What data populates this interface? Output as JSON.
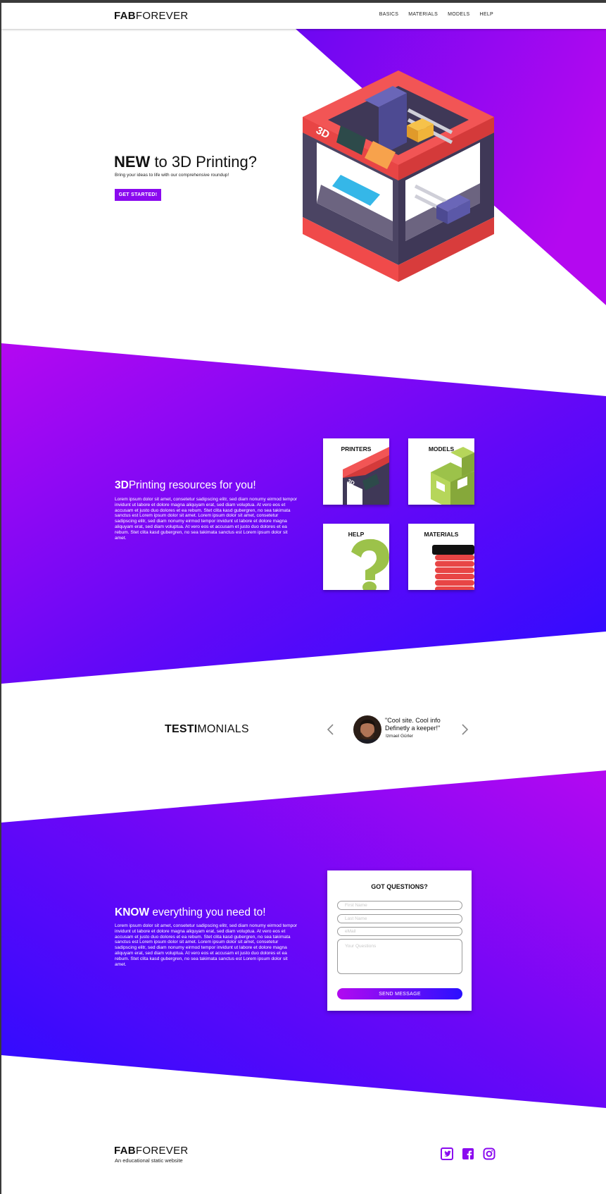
{
  "header": {
    "logo_bold": "FAB",
    "logo_light": "FOREVER",
    "nav": [
      "BASICS",
      "MATERIALS",
      "MODELS",
      "HELP"
    ]
  },
  "hero": {
    "title_bold": "NEW",
    "title_rest": " to 3D Printing?",
    "subtitle": "Bring your ideas to life with our comprehensive roundup!",
    "cta": "GET STARTED!",
    "printer_badge": "3D"
  },
  "resources": {
    "title_bold": "3D",
    "title_rest": "Printing resources for you!",
    "body": "Lorem ipsum dolor sit amet, consetetur sadipscing elitr, sed diam nonumy eirmod tempor invidunt ut labore et dolore magna aliquyam erat, sed diam voluptua. At vero eos et accusam et justo duo dolores et ea rebum. Stet clita kasd gubergren, no sea takimata sanctus est Lorem ipsum dolor sit amet. Lorem ipsum dolor sit amet, consetetur sadipscing elitr, sed diam nonumy eirmod tempor invidunt ut labore et dolore magna aliquyam erat, sed diam voluptua. At vero eos et accusam et justo duo dolores et ea rebum. Stet clita kasd gubergren, no sea takimata sanctus est Lorem ipsum dolor sit amet.",
    "cards": [
      "PRINTERS",
      "MODELS",
      "HELP",
      "MATERIALS"
    ],
    "card_badge": "3D"
  },
  "testimonials": {
    "title_bold": "TESTI",
    "title_rest": "MONIALS",
    "quote": "\"Cool site. Cool info Definetly a keeper!\"",
    "author": "Izmael Gürler"
  },
  "contact": {
    "title_bold": "KNOW",
    "title_rest": " everything you need to!",
    "body": "Lorem ipsum dolor sit amet, consetetur sadipscing elitr, sed diam nonumy eirmod tempor invidunt ut labore et dolore magna aliquyam erat, sed diam voluptua. At vero eos et accusam et justo duo dolores et ea rebum. Stet clita kasd gubergren, no sea takimata sanctus est Lorem ipsum dolor sit amet. Lorem ipsum dolor sit amet, consetetur sadipscing elitr, sed diam nonumy eirmod tempor invidunt ut labore et dolore magna aliquyam erat, sed diam voluptua. At vero eos et accusam et justo duo dolores et ea rebum. Stet clita kasd gubergren, no sea takimata sanctus est Lorem ipsum dolor sit amet.",
    "form_title": "GOT QUESTIONS?",
    "first_name_placeholder": "First Name",
    "last_name_placeholder": "Last Name",
    "email_placeholder": "eMail",
    "questions_placeholder": "Your Questions",
    "send": "SEND MESSAGE"
  },
  "footer": {
    "logo_bold": "FAB",
    "logo_light": "FOREVER",
    "tagline": "An educational static website",
    "social_icons": [
      "twitter-icon",
      "facebook-icon",
      "instagram-icon"
    ]
  },
  "colors": {
    "purple": "#b20af0",
    "violet": "#8a0aef",
    "blue": "#2a10ff",
    "printer_red": "#f04f4f",
    "printer_dark": "#463f5c"
  }
}
